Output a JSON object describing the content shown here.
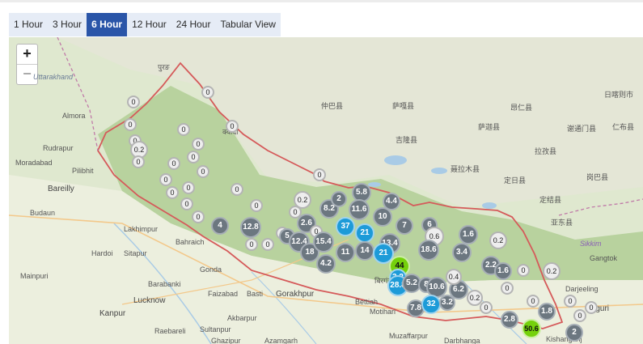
{
  "tabs": [
    {
      "label": "1 Hour",
      "active": false
    },
    {
      "label": "3 Hour",
      "active": false
    },
    {
      "label": "6 Hour",
      "active": true
    },
    {
      "label": "12 Hour",
      "active": false
    },
    {
      "label": "24 Hour",
      "active": false
    },
    {
      "label": "Tabular View",
      "active": false
    }
  ],
  "zoom": {
    "in_label": "+",
    "out_label": "−"
  },
  "place_labels": [
    "Uttarakhand",
    "Almora",
    "Rudrapur",
    "Moradabad",
    "Pilibhit",
    "Bareilly",
    "Budaun",
    "Lakhimpur",
    "Hardoi",
    "Sitapur",
    "Bahraich",
    "Mainpuri",
    "Lucknow",
    "Gonda",
    "Barabanki",
    "Basti",
    "Gorakhpur",
    "Bettiah",
    "Motihari",
    "Faizabad",
    "Sultanpur",
    "Raebareli",
    "Akbarpur",
    "Azamgarh",
    "Kanpur",
    "Muzaffarpur",
    "Darbhanga",
    "Kishanganj",
    "Siliguri",
    "Gangtok",
    "Darjeeling",
    "Sikkim",
    "Ghazipur",
    "पुरङ",
    "仲巴县",
    "萨嘎县",
    "吉隆县",
    "聂拉木县",
    "定日县",
    "岗巴县",
    "拉孜县",
    "定结县",
    "亚东县",
    "昂仁县",
    "谢通门县",
    "日喀则市",
    "萨迦县",
    "仁布县",
    "क्यादी",
    "बिरगंज"
  ],
  "marker_colors": {
    "zero": "#eeeeee",
    "grey": "#6c7780",
    "blue": "#1d9bd8",
    "green": "#75d10c"
  },
  "markers": [
    {
      "v": "0",
      "c": "zero"
    },
    {
      "v": "0",
      "c": "zero"
    },
    {
      "v": "0",
      "c": "zero"
    },
    {
      "v": "0",
      "c": "zero"
    },
    {
      "v": "0",
      "c": "zero"
    },
    {
      "v": "0.2",
      "c": "zero"
    },
    {
      "v": "0",
      "c": "zero"
    },
    {
      "v": "0",
      "c": "zero"
    },
    {
      "v": "0",
      "c": "zero"
    },
    {
      "v": "0",
      "c": "zero"
    },
    {
      "v": "0",
      "c": "zero"
    },
    {
      "v": "0",
      "c": "zero"
    },
    {
      "v": "0",
      "c": "zero"
    },
    {
      "v": "0",
      "c": "zero"
    },
    {
      "v": "0",
      "c": "zero"
    },
    {
      "v": "0",
      "c": "zero"
    },
    {
      "v": "0",
      "c": "zero"
    },
    {
      "v": "0",
      "c": "zero"
    },
    {
      "v": "0",
      "c": "zero"
    },
    {
      "v": "0",
      "c": "zero"
    },
    {
      "v": "4",
      "c": "grey"
    },
    {
      "v": "12.8",
      "c": "grey"
    },
    {
      "v": "0",
      "c": "zero"
    },
    {
      "v": "0",
      "c": "zero"
    },
    {
      "v": "0",
      "c": "zero"
    },
    {
      "v": "0",
      "c": "zero"
    },
    {
      "v": "2.6",
      "c": "grey"
    },
    {
      "v": "0.2",
      "c": "zero"
    },
    {
      "v": "8.2",
      "c": "grey"
    },
    {
      "v": "2",
      "c": "grey"
    },
    {
      "v": "0",
      "c": "zero"
    },
    {
      "v": "5",
      "c": "grey"
    },
    {
      "v": "12.4",
      "c": "grey"
    },
    {
      "v": "18",
      "c": "grey"
    },
    {
      "v": "15.4",
      "c": "grey"
    },
    {
      "v": "11",
      "c": "grey"
    },
    {
      "v": "4.2",
      "c": "grey"
    },
    {
      "v": "5.8",
      "c": "grey"
    },
    {
      "v": "11.6",
      "c": "grey"
    },
    {
      "v": "10",
      "c": "grey"
    },
    {
      "v": "4.4",
      "c": "grey"
    },
    {
      "v": "37",
      "c": "blue"
    },
    {
      "v": "21",
      "c": "blue"
    },
    {
      "v": "7",
      "c": "grey"
    },
    {
      "v": "13.4",
      "c": "grey"
    },
    {
      "v": "14",
      "c": "grey"
    },
    {
      "v": "21",
      "c": "blue"
    },
    {
      "v": "6",
      "c": "grey"
    },
    {
      "v": "0.6",
      "c": "zero"
    },
    {
      "v": "18.6",
      "c": "grey"
    },
    {
      "v": "44",
      "c": "green"
    },
    {
      "v": "3.2",
      "c": "grey"
    },
    {
      "v": "28.8",
      "c": "grey"
    },
    {
      "v": "5.2",
      "c": "grey"
    },
    {
      "v": "8",
      "c": "grey"
    },
    {
      "v": "10.6",
      "c": "grey"
    },
    {
      "v": "6.2",
      "c": "grey"
    },
    {
      "v": "0.4",
      "c": "zero"
    },
    {
      "v": "7.8",
      "c": "grey"
    },
    {
      "v": "32",
      "c": "blue"
    },
    {
      "v": "3.2",
      "c": "grey"
    },
    {
      "v": "1.6",
      "c": "grey"
    },
    {
      "v": "3.4",
      "c": "grey"
    },
    {
      "v": "0.2",
      "c": "zero"
    },
    {
      "v": "2.2",
      "c": "grey"
    },
    {
      "v": "1.6",
      "c": "grey"
    },
    {
      "v": "0.2",
      "c": "zero"
    },
    {
      "v": "0",
      "c": "zero"
    },
    {
      "v": "0.2",
      "c": "zero"
    },
    {
      "v": "0",
      "c": "zero"
    },
    {
      "v": "0",
      "c": "zero"
    },
    {
      "v": "0",
      "c": "zero"
    },
    {
      "v": "0",
      "c": "zero"
    },
    {
      "v": "1.8",
      "c": "grey"
    },
    {
      "v": "2.8",
      "c": "grey"
    },
    {
      "v": "50.6",
      "c": "green"
    },
    {
      "v": "2",
      "c": "grey"
    },
    {
      "v": "0",
      "c": "zero"
    },
    {
      "v": "0",
      "c": "zero"
    }
  ]
}
